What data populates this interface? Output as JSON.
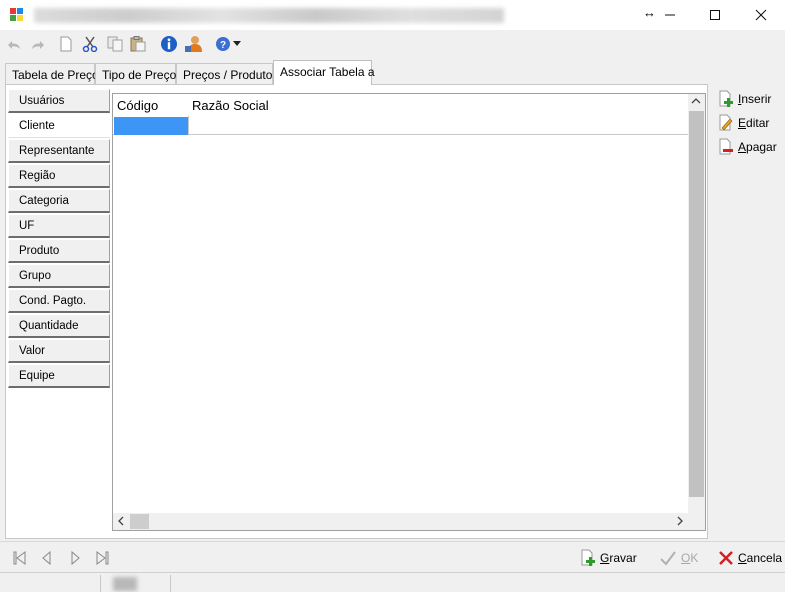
{
  "window": {
    "title": "",
    "controls": {
      "minimize_icon": "minimize-icon",
      "maximize_icon": "maximize-icon",
      "close_icon": "close-icon"
    }
  },
  "toolbar": {
    "icons": [
      "undo-icon",
      "redo-icon",
      "new-document-icon",
      "cut-icon",
      "copy-icon",
      "paste-icon",
      "info-icon",
      "user-icon",
      "help-icon",
      "dropdown-arrow-icon"
    ]
  },
  "tabs": [
    {
      "label": "Tabela de Preço"
    },
    {
      "label": "Tipo de Preços"
    },
    {
      "label": "Preços / Produtos"
    },
    {
      "label": "Associar Tabela a",
      "active": true
    }
  ],
  "side_items": [
    {
      "label": "Usuários"
    },
    {
      "label": "Cliente",
      "active": true
    },
    {
      "label": "Representante"
    },
    {
      "label": "Região"
    },
    {
      "label": "Categoria"
    },
    {
      "label": "UF"
    },
    {
      "label": "Produto"
    },
    {
      "label": "Grupo"
    },
    {
      "label": "Cond. Pagto."
    },
    {
      "label": "Quantidade"
    },
    {
      "label": "Valor"
    },
    {
      "label": "Equipe"
    }
  ],
  "grid": {
    "columns": [
      "Código",
      "Razão Social"
    ],
    "rows": [
      [
        "",
        ""
      ]
    ]
  },
  "actions": {
    "insert": "Inserir",
    "edit": "Editar",
    "delete": "Apagar"
  },
  "footer": {
    "save": "Gravar",
    "ok": "OK",
    "cancel": "Cancela"
  },
  "colors": {
    "selection": "#3d96f6",
    "accent_red": "#d32020",
    "accent_green": "#2e9b2e",
    "info_blue": "#1c5fc7"
  }
}
